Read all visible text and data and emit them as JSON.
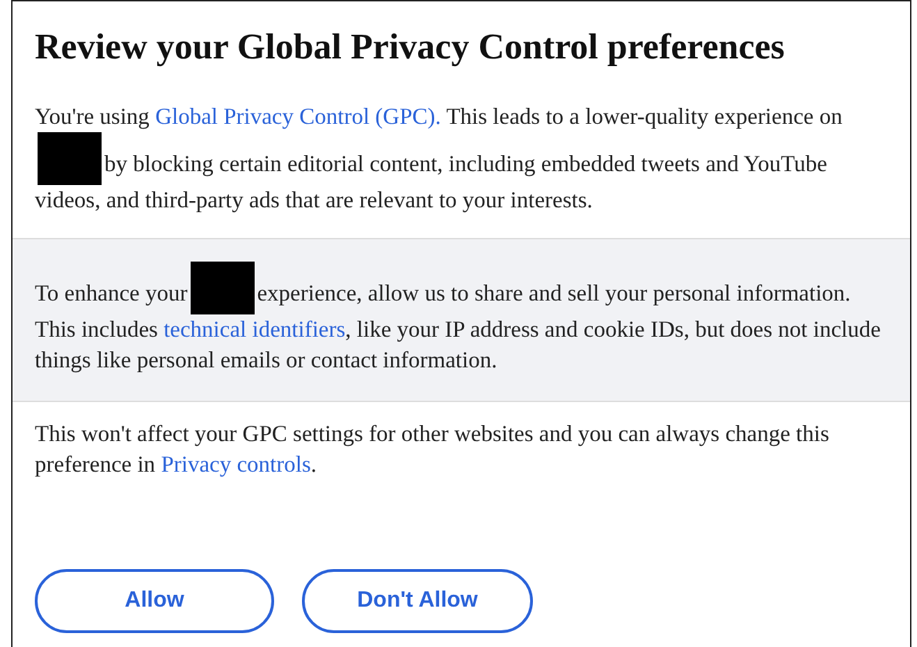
{
  "dialog": {
    "title": "Review your Global Privacy Control preferences",
    "sections": [
      {
        "shaded": false,
        "segments": [
          {
            "kind": "text",
            "text": "You're using "
          },
          {
            "kind": "link",
            "text": "Global Privacy Control (GPC)."
          },
          {
            "kind": "text",
            "text": " This leads to a lower-quality experience on"
          },
          {
            "kind": "redaction"
          },
          {
            "kind": "text",
            "text": "by blocking certain editorial content, including embedded tweets and YouTube videos, and third-party ads that are relevant to your interests."
          }
        ]
      },
      {
        "shaded": true,
        "segments": [
          {
            "kind": "text",
            "text": "To enhance your"
          },
          {
            "kind": "redaction"
          },
          {
            "kind": "text",
            "text": "experience, allow us to share and sell your personal information. This includes "
          },
          {
            "kind": "link",
            "text": "technical identifiers"
          },
          {
            "kind": "text",
            "text": ", like your IP address and cookie IDs, but does not include things like personal emails or contact information."
          }
        ]
      },
      {
        "shaded": false,
        "segments": [
          {
            "kind": "text",
            "text": "This won't affect your GPC settings for other websites and you can always change this preference in "
          },
          {
            "kind": "link",
            "text": "Privacy controls"
          },
          {
            "kind": "text",
            "text": "."
          }
        ]
      }
    ],
    "buttons": [
      "Allow",
      "Don't Allow"
    ]
  }
}
